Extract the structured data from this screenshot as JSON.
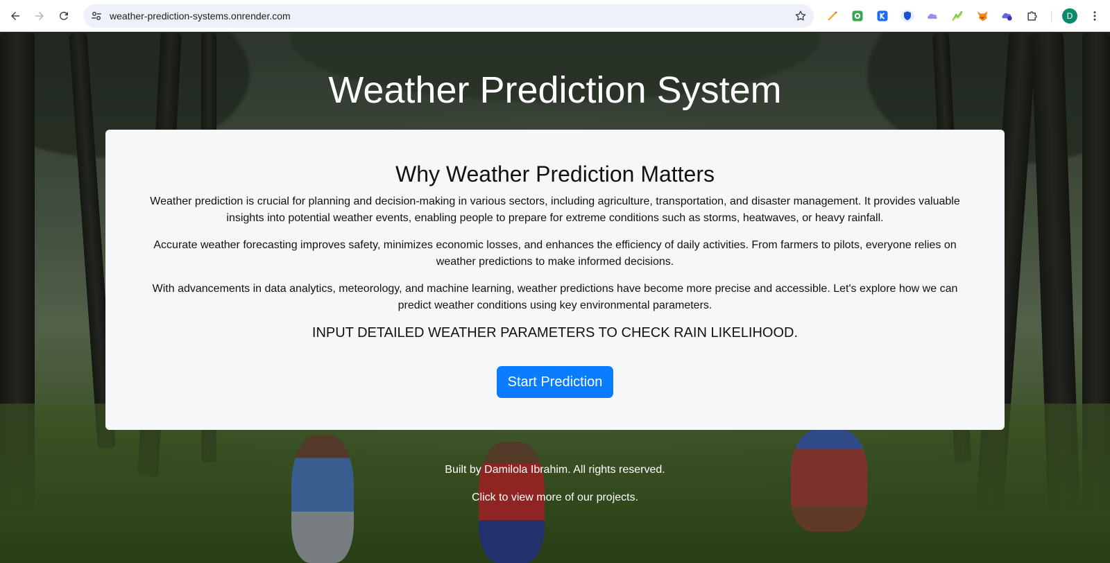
{
  "browser": {
    "url": "weather-prediction-systems.onrender.com",
    "profile_initial": "D",
    "extensions": [
      "pen-icon",
      "android-icon",
      "k-icon",
      "shield-icon",
      "cloud-icon",
      "chart-icon",
      "fox-icon",
      "cloud-shield-icon",
      "puzzle-icon"
    ]
  },
  "page": {
    "title": "Weather Prediction System",
    "card": {
      "heading": "Why Weather Prediction Matters",
      "paragraphs": [
        "Weather prediction is crucial for planning and decision-making in various sectors, including agriculture, transportation, and disaster management. It provides valuable insights into potential weather events, enabling people to prepare for extreme conditions such as storms, heatwaves, or heavy rainfall.",
        "Accurate weather forecasting improves safety, minimizes economic losses, and enhances the efficiency of daily activities. From farmers to pilots, everyone relies on weather predictions to make informed decisions.",
        "With advancements in data analytics, meteorology, and machine learning, weather predictions have become more precise and accessible. Let's explore how we can predict weather conditions using key environmental parameters."
      ],
      "cta_text": "INPUT DETAILED WEATHER PARAMETERS TO CHECK RAIN LIKELIHOOD.",
      "button_label": "Start Prediction"
    },
    "footer": {
      "credit": "Built by Damilola Ibrahim. All rights reserved.",
      "projects_link": "Click to view more of our projects."
    }
  },
  "colors": {
    "button": "#0a7cff",
    "card_bg": "#f6f7f9",
    "title_text": "#ffffff"
  }
}
